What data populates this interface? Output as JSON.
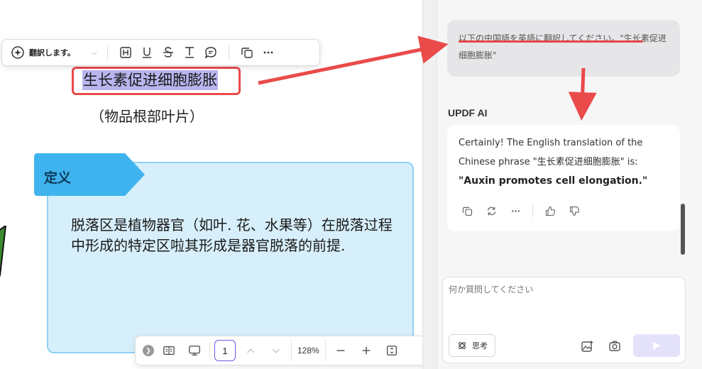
{
  "document": {
    "selected_text": "生长素促进细胞膨胀",
    "subtitle": "（物品根部叶片）",
    "definition_tag": "定义",
    "definition_body": "脱落区是植物器官（如叶. 花、水果等）在脱落过程中形成的特定区啦其形成是器官脱落的前提."
  },
  "floating_toolbar": {
    "translate_label": "翻訳します。",
    "icons": [
      "translate-icon",
      "chevron-down-icon",
      "highlight-icon",
      "underline-icon",
      "strikethrough-icon",
      "text-icon",
      "comment-icon",
      "copy-icon",
      "more-icon"
    ]
  },
  "bottom_toolbar": {
    "page_number": "1",
    "zoom": "128%",
    "icons": [
      "collapse-icon",
      "reading-mode-icon",
      "presentation-icon",
      "page-up-icon",
      "page-down-icon",
      "zoom-out-icon",
      "zoom-in-icon",
      "fit-page-icon"
    ]
  },
  "ai_panel": {
    "user_message": "以下の中国語を英語に翻訳してください。\"生长素促进细胞膨胀\"",
    "assistant_name": "UPDF AI",
    "response_line1": "Certainly! The English translation of the",
    "response_line2": "Chinese phrase \"生长素促进细胞膨胀\" is:",
    "response_answer": "\"Auxin promotes cell elongation.\"",
    "action_icons": [
      "copy-icon",
      "regenerate-icon",
      "more-icon",
      "thumbs-up-icon",
      "thumbs-down-icon"
    ],
    "input_placeholder": "何か質問してください",
    "think_label": "思考",
    "input_icons": [
      "image-upload-icon",
      "screenshot-icon",
      "send-icon"
    ]
  },
  "colors": {
    "highlight_box": "#ea4a4a",
    "selection_fill": "#b9b5ef",
    "definition_fill": "#d7effb",
    "definition_tag": "#3fb3ee",
    "accent": "#6a5be8",
    "annotation_arrow": "#ea4a4a"
  }
}
